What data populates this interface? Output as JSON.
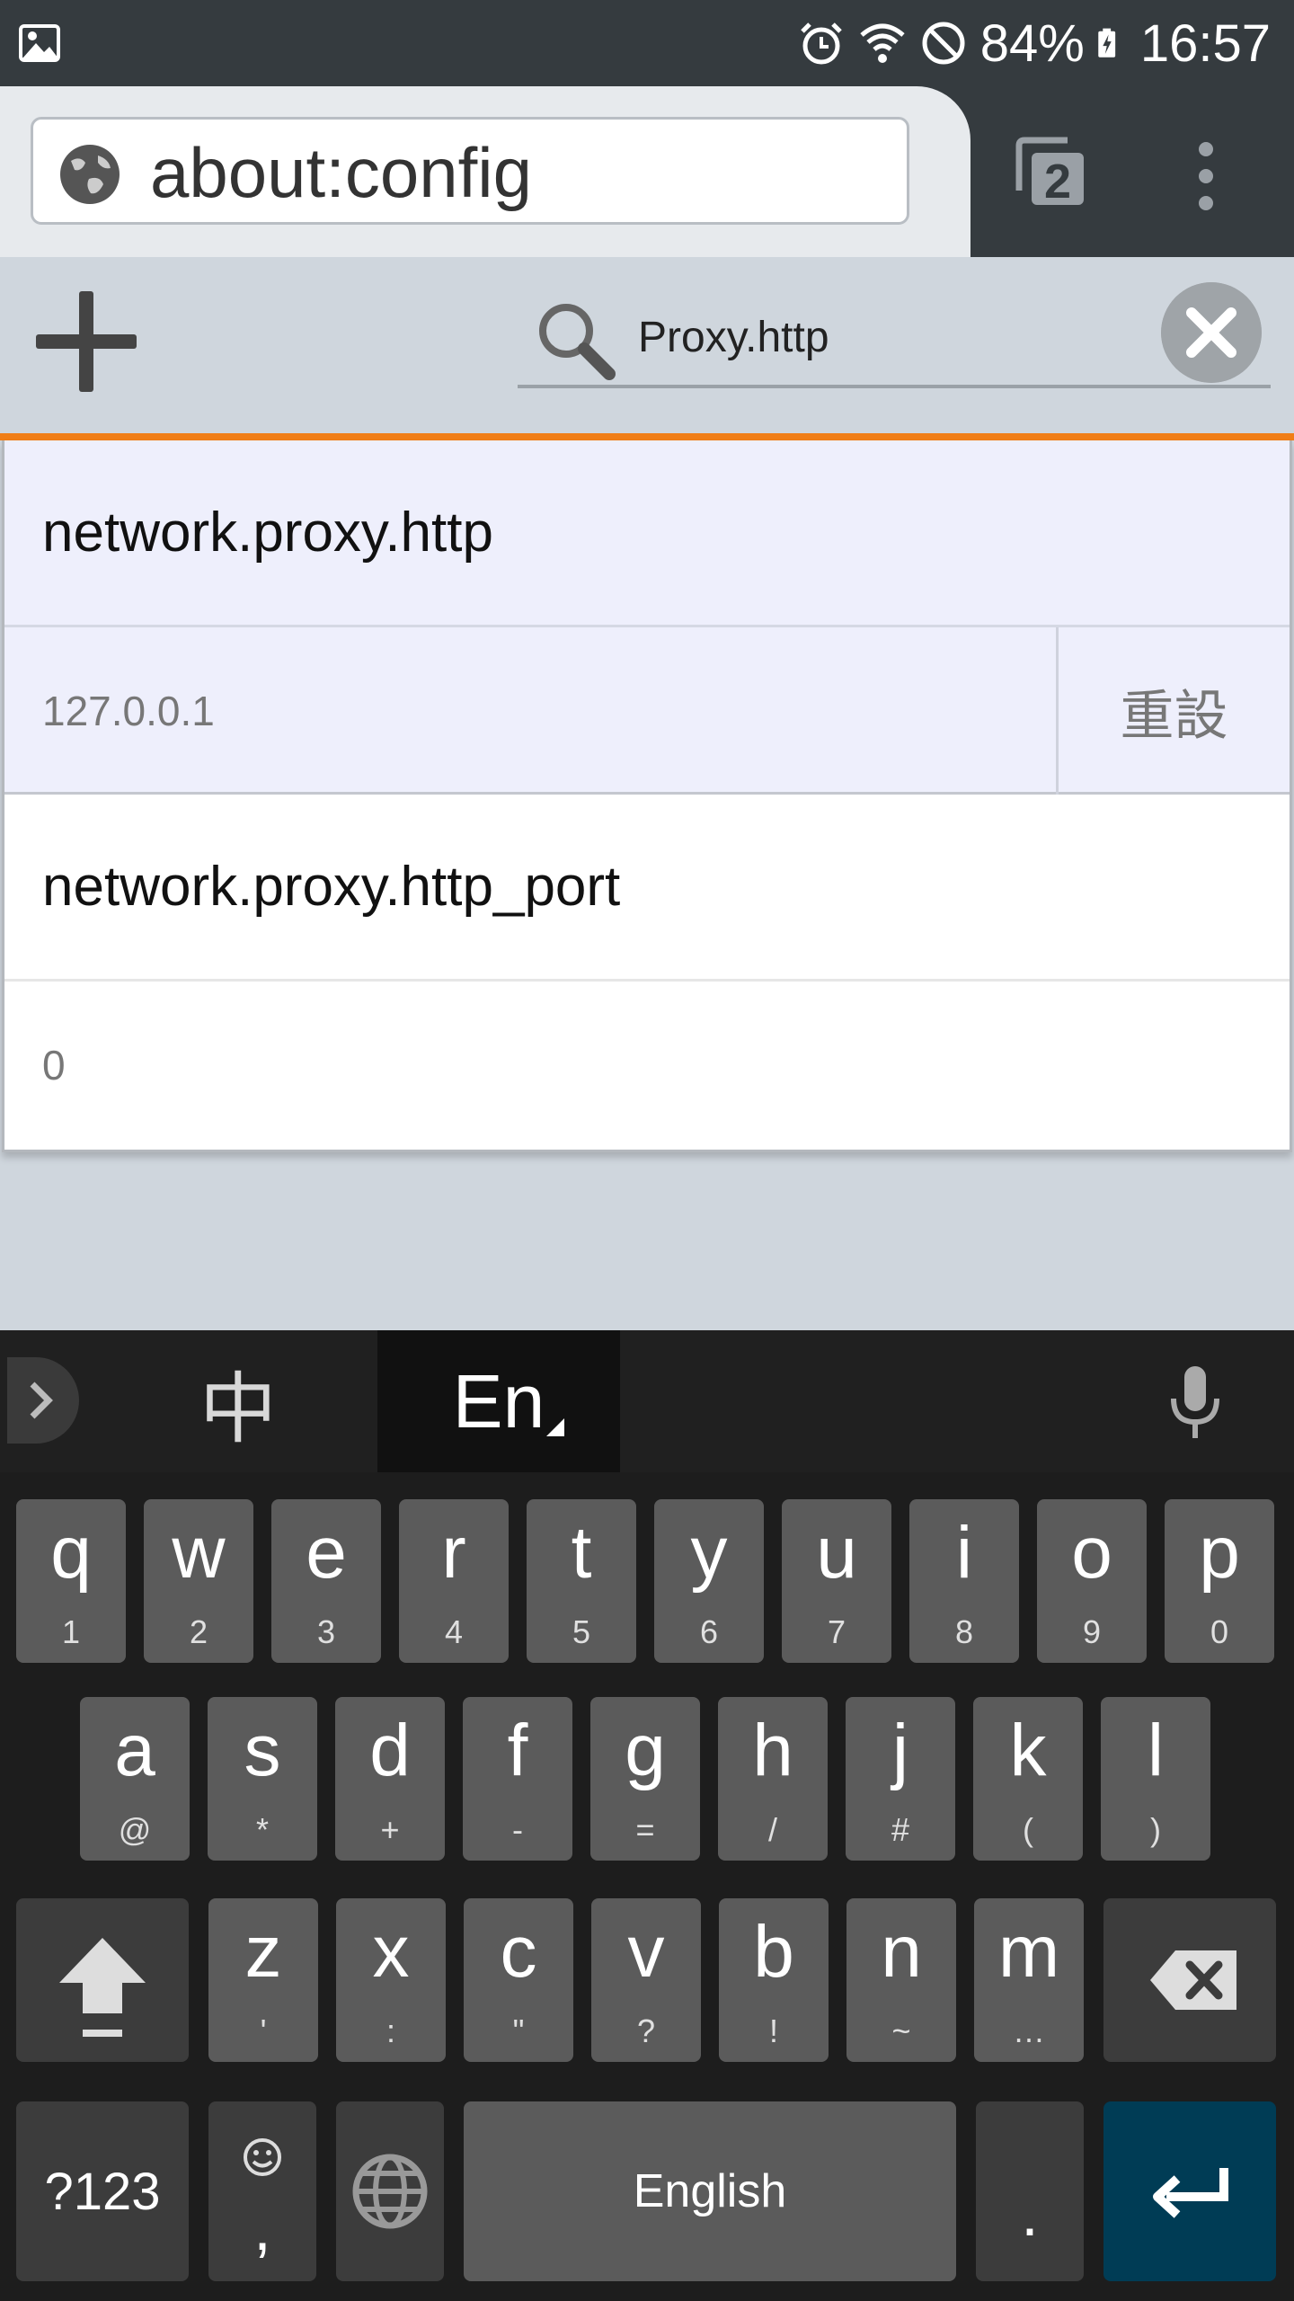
{
  "status_bar": {
    "battery": "84%",
    "time": "16:57"
  },
  "browser": {
    "url": "about:config",
    "tabs_count": "2"
  },
  "toolbar": {
    "search_value": "Proxy.http"
  },
  "prefs": [
    {
      "name": "network.proxy.http",
      "value": "127.0.0.1",
      "reset_label": "重設"
    },
    {
      "name": "network.proxy.http_port",
      "value": "0"
    }
  ],
  "keyboard": {
    "lang_zh": "中",
    "lang_en": "En",
    "row1": [
      {
        "k": "q",
        "s": "1"
      },
      {
        "k": "w",
        "s": "2"
      },
      {
        "k": "e",
        "s": "3"
      },
      {
        "k": "r",
        "s": "4"
      },
      {
        "k": "t",
        "s": "5"
      },
      {
        "k": "y",
        "s": "6"
      },
      {
        "k": "u",
        "s": "7"
      },
      {
        "k": "i",
        "s": "8"
      },
      {
        "k": "o",
        "s": "9"
      },
      {
        "k": "p",
        "s": "0"
      }
    ],
    "row2": [
      {
        "k": "a",
        "s": "@"
      },
      {
        "k": "s",
        "s": "*"
      },
      {
        "k": "d",
        "s": "+"
      },
      {
        "k": "f",
        "s": "-"
      },
      {
        "k": "g",
        "s": "="
      },
      {
        "k": "h",
        "s": "/"
      },
      {
        "k": "j",
        "s": "#"
      },
      {
        "k": "k",
        "s": "("
      },
      {
        "k": "l",
        "s": ")"
      }
    ],
    "row3": [
      {
        "k": "z",
        "s": "'"
      },
      {
        "k": "x",
        "s": ":"
      },
      {
        "k": "c",
        "s": "\""
      },
      {
        "k": "v",
        "s": "?"
      },
      {
        "k": "b",
        "s": "!"
      },
      {
        "k": "n",
        "s": "~"
      },
      {
        "k": "m",
        "s": "…"
      }
    ],
    "symbols_label": "?123",
    "comma_label": ",",
    "space_label": "English",
    "period_label": "."
  },
  "colors": {
    "accent_orange": "#f07e17",
    "enter_key": "#003c55",
    "selected_row": "#eeeffc"
  }
}
